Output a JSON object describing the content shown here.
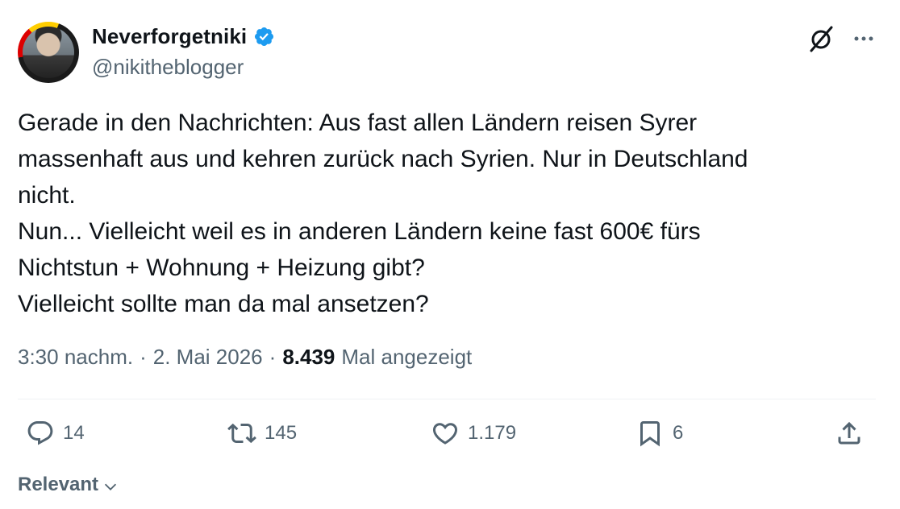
{
  "author": {
    "display_name": "Neverforgetniki",
    "handle": "@nikitheblogger",
    "verified": true
  },
  "tweet": {
    "text": "Gerade in den Nachrichten: Aus fast allen Ländern reisen Syrer\nmassenhaft aus und kehren zurück nach Syrien. Nur in Deutschland\nnicht.\nNun... Vielleicht weil es in anderen Ländern keine fast 600€ fürs\nNichtstun + Wohnung + Heizung gibt?\nVielleicht sollte man da mal ansetzen?",
    "time": "3:30 nachm.",
    "separator": "·",
    "date": "2. Mai 2026",
    "views_count": "8.439",
    "views_label": "Mal angezeigt"
  },
  "actions": {
    "replies": "14",
    "retweets": "145",
    "likes": "1.179",
    "bookmarks": "6"
  },
  "sort": {
    "label": "Relevant"
  },
  "colors": {
    "text": "#0f1419",
    "secondary": "#536471",
    "verified_blue": "#1d9bf0",
    "divider": "#eff3f4"
  },
  "icons": [
    "verified-badge-icon",
    "grok-icon",
    "more-icon",
    "reply-icon",
    "retweet-icon",
    "like-icon",
    "bookmark-icon",
    "share-icon",
    "chevron-down-icon"
  ]
}
